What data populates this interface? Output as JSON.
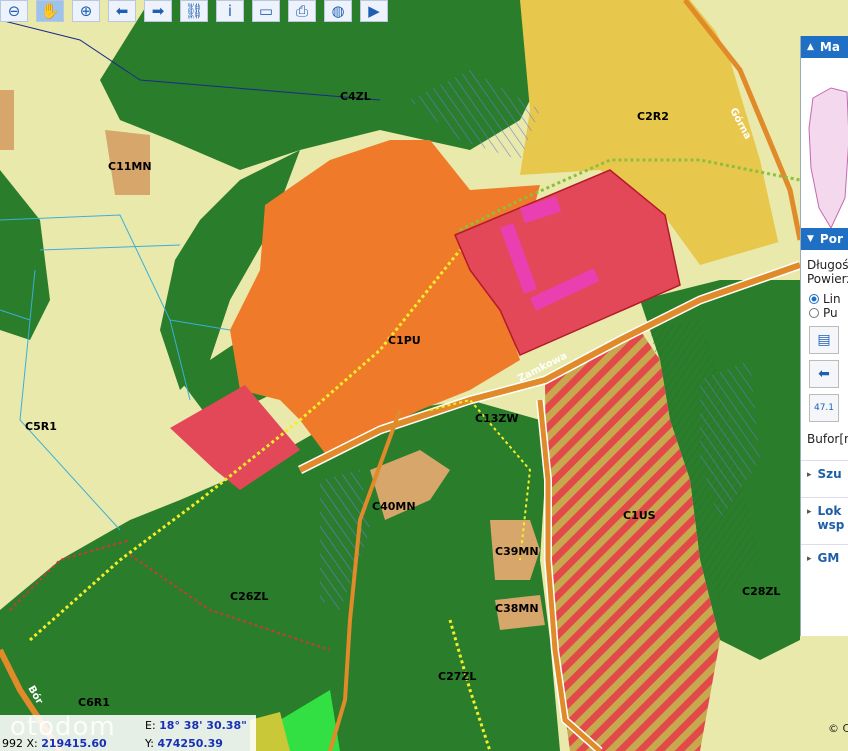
{
  "toolbar": {
    "tools": [
      {
        "name": "zoom-out-tool",
        "icon": "magnifier-minus-icon",
        "glyph": "⊖"
      },
      {
        "name": "pan-tool",
        "icon": "hand-icon",
        "glyph": "✋"
      },
      {
        "name": "zoom-in-tool",
        "icon": "magnifier-plus-icon",
        "glyph": "⊕"
      },
      {
        "name": "back-tool",
        "icon": "arrow-left-icon",
        "glyph": "⬅"
      },
      {
        "name": "forward-tool",
        "icon": "arrow-right-icon",
        "glyph": "➡"
      },
      {
        "name": "link-tool",
        "icon": "chain-link-icon",
        "glyph": "⛓"
      },
      {
        "name": "info-tool",
        "icon": "info-icon",
        "glyph": "i"
      },
      {
        "name": "measure-tool",
        "icon": "ruler-icon",
        "glyph": "▭"
      },
      {
        "name": "print-tool",
        "icon": "printer-icon",
        "glyph": "⎙"
      },
      {
        "name": "globe-tool",
        "icon": "globe-icon",
        "glyph": "◍"
      },
      {
        "name": "video-tool",
        "icon": "camera-icon",
        "glyph": "▶"
      }
    ]
  },
  "map": {
    "labels": {
      "c4zl": "C4ZL",
      "c2r2": "C2R2",
      "c1pu": "C1PU",
      "c5r1": "C5R1",
      "c13zw": "C13ZW",
      "c40mn": "C40MN",
      "c39mn": "C39MN",
      "c38mn": "C38MN",
      "c26zl": "C26ZL",
      "c1us": "C1US",
      "c28zl": "C28ZL",
      "c27zl": "C27ZL",
      "c6r1": "C6R1",
      "c11mn": "C11MN"
    },
    "streets": {
      "zamkowa": "Zamkowa",
      "gorna": "Górna",
      "bor": "Bór"
    },
    "colors": {
      "forest": "#1e7a1e",
      "industrial": "#f07a2a",
      "services": "#e04a5a",
      "agricultural": "#e8e8a8",
      "farmland": "#e6c84a",
      "road": "#e08a2a",
      "housing": "#d9a66a"
    }
  },
  "panel": {
    "sections": [
      {
        "label": "Ma",
        "arrow": "▲"
      },
      {
        "label": "Por",
        "arrow": "▼"
      }
    ],
    "texts": [
      "Długoś",
      "Powierz"
    ],
    "radios": [
      {
        "label": "Lin",
        "selected": true
      },
      {
        "label": "Pu",
        "selected": false
      }
    ],
    "buffer_label": "Bufor[m",
    "value_label": "47.1",
    "links": [
      "Szu",
      "Lok wsp",
      "GM"
    ]
  },
  "coords": {
    "geo_left": "",
    "east_key": "E:",
    "east_value": "18° 38' 30.38\"",
    "x_key": "X:",
    "x_value": "219415.60",
    "y_key": "Y:",
    "y_value": "474250.39",
    "left_num": "992"
  },
  "watermark": "otodom",
  "copyright": "© C"
}
